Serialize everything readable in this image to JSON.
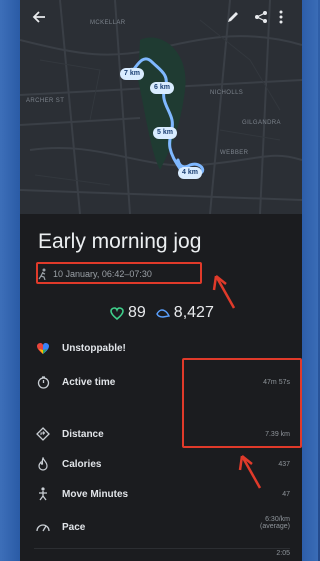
{
  "map": {
    "km_badges": [
      "7 km",
      "6 km",
      "5 km",
      "4 km"
    ],
    "labels": [
      "ARCHER ST",
      "NICHOLLS",
      "WEBBER",
      "MCKELLAR",
      "GILGANDRA"
    ]
  },
  "header": {
    "back_icon": "arrow-left-icon",
    "edit_icon": "pencil-icon",
    "share_icon": "share-icon",
    "more_icon": "more-vert-icon"
  },
  "activity": {
    "title": "Early morning jog",
    "date": "10 January, 06:42–07:30",
    "heart_points": "89",
    "steps": "8,427"
  },
  "metrics": [
    {
      "label": "Unstoppable!",
      "value": "",
      "icon": "heart-multicolor-icon"
    },
    {
      "label": "Active time",
      "value": "47m 57s",
      "icon": "timer-icon"
    },
    {
      "label": "Distance",
      "value": "7.39 km",
      "icon": "distance-icon"
    },
    {
      "label": "Calories",
      "value": "437",
      "icon": "flame-icon"
    },
    {
      "label": "Move Minutes",
      "value": "47",
      "icon": "walk-icon"
    },
    {
      "label": "Pace",
      "value": "6:30/km",
      "value2": "(average)",
      "icon": "pace-icon"
    }
  ],
  "footer_value": "2:05",
  "colors": {
    "accent_red": "#e03a2a",
    "heart_green": "#3fd08b",
    "steps_blue": "#5aa0ff",
    "route_blue": "#7fb8ff"
  }
}
